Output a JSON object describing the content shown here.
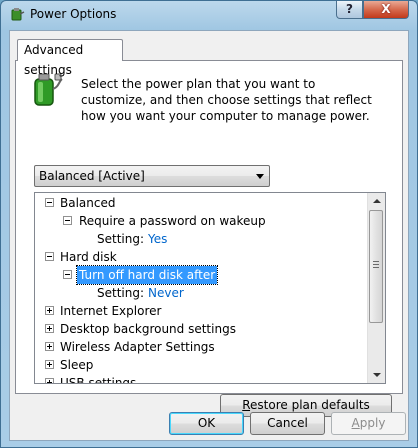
{
  "window": {
    "title": "Power Options",
    "help_button": "?",
    "close_button": "X"
  },
  "tab": {
    "label": "Advanced settings"
  },
  "description": "Select the power plan that you want to customize, and then choose settings that reflect how you want your computer to manage power.",
  "plan_select": {
    "value": "Balanced [Active]"
  },
  "tree": {
    "rows": [
      {
        "label": "Balanced",
        "value": ""
      },
      {
        "label": "Require a password on wakeup",
        "value": ""
      },
      {
        "label": "Setting:",
        "value": "Yes"
      },
      {
        "label": "Hard disk",
        "value": ""
      },
      {
        "label": "Turn off hard disk after",
        "value": ""
      },
      {
        "label": "Setting:",
        "value": "Never"
      },
      {
        "label": "Internet Explorer",
        "value": ""
      },
      {
        "label": "Desktop background settings",
        "value": ""
      },
      {
        "label": "Wireless Adapter Settings",
        "value": ""
      },
      {
        "label": "Sleep",
        "value": ""
      },
      {
        "label": "USB settings",
        "value": ""
      }
    ]
  },
  "buttons": {
    "restore_pre": "",
    "restore_underlined": "R",
    "restore_post": "estore plan defaults",
    "ok": "OK",
    "cancel": "Cancel",
    "apply_underlined": "A",
    "apply_post": "pply"
  },
  "colors": {
    "link": "#0066cc",
    "selection": "#3399ff"
  },
  "icons": {
    "app": "power-options-icon",
    "plan": "battery-plug-icon"
  }
}
